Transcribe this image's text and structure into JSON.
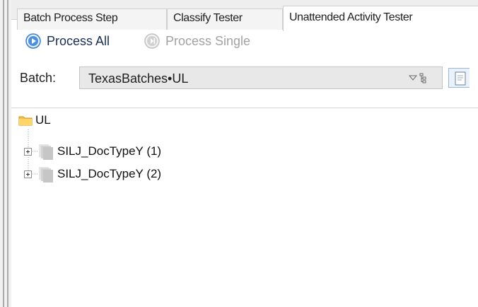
{
  "tabs": [
    {
      "label": "Batch Process Step",
      "active": false
    },
    {
      "label": "Classify Tester",
      "active": false
    },
    {
      "label": "Unattended Activity Tester",
      "active": true
    }
  ],
  "toolbar": {
    "process_all_label": "Process All",
    "process_single_label": "Process Single"
  },
  "batch": {
    "label": "Batch:",
    "selected": "TexasBatches•UL"
  },
  "tree": {
    "root": {
      "label": "UL",
      "icon": "folder-icon"
    },
    "children": [
      {
        "label": "SILJ_DocTypeY (1)",
        "icon": "document-stack-icon"
      },
      {
        "label": "SILJ_DocTypeY (2)",
        "icon": "document-stack-icon"
      }
    ]
  },
  "colors": {
    "accent": "#1a2d55",
    "disabled_text": "#a2a2a2",
    "folder": "#f4c248",
    "play_blue": "#4a8fe0"
  }
}
